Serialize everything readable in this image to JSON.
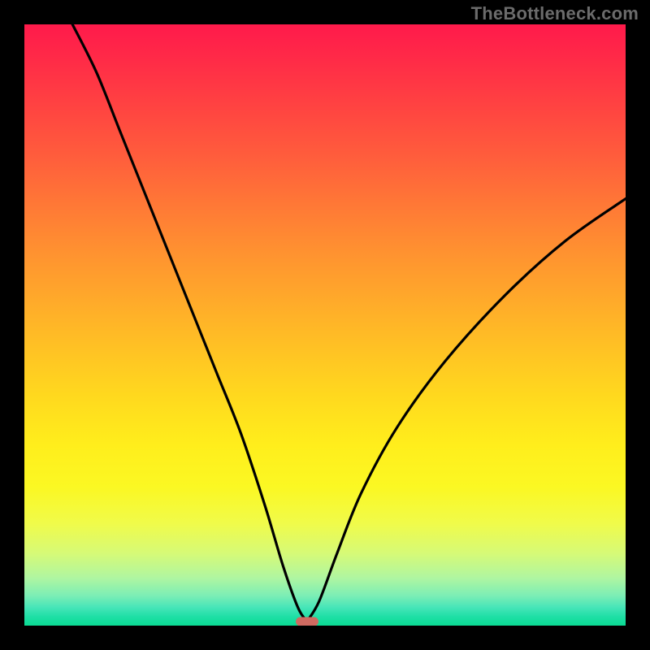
{
  "watermark": "TheBottleneck.com",
  "colors": {
    "frame_bg": "#000000",
    "watermark": "#6b6b6b",
    "curve_stroke": "#000000",
    "marker": "#cf6a61",
    "gradient_stops": [
      "#ff1a4b",
      "#ff2b47",
      "#ff4441",
      "#ff5d3c",
      "#ff7836",
      "#ff9230",
      "#ffaa2a",
      "#ffc224",
      "#ffd91e",
      "#ffee1c",
      "#fbf823",
      "#f0fb4a",
      "#d6fa77",
      "#b0f6a0",
      "#7ceeb5",
      "#46e5b8",
      "#1fdfa6",
      "#0adb93"
    ]
  },
  "chart_data": {
    "type": "line",
    "title": "",
    "xlabel": "",
    "ylabel": "",
    "xlim": [
      0,
      100
    ],
    "ylim": [
      0,
      100
    ],
    "notch_x": 47,
    "marker": {
      "x": 47,
      "y": 0.7,
      "color": "#cf6a61"
    },
    "left_branch": [
      {
        "x": 8,
        "y": 100
      },
      {
        "x": 12,
        "y": 92
      },
      {
        "x": 16,
        "y": 82
      },
      {
        "x": 20,
        "y": 72
      },
      {
        "x": 24,
        "y": 62
      },
      {
        "x": 28,
        "y": 52
      },
      {
        "x": 32,
        "y": 42
      },
      {
        "x": 36,
        "y": 32
      },
      {
        "x": 40,
        "y": 20
      },
      {
        "x": 43,
        "y": 10
      },
      {
        "x": 45.5,
        "y": 3
      },
      {
        "x": 47,
        "y": 0.7
      }
    ],
    "right_branch": [
      {
        "x": 47,
        "y": 0.7
      },
      {
        "x": 49,
        "y": 4
      },
      {
        "x": 52,
        "y": 12
      },
      {
        "x": 56,
        "y": 22
      },
      {
        "x": 62,
        "y": 33
      },
      {
        "x": 70,
        "y": 44
      },
      {
        "x": 80,
        "y": 55
      },
      {
        "x": 90,
        "y": 64
      },
      {
        "x": 100,
        "y": 71
      }
    ],
    "note": "Values are approximate, read visually from the plot; x and y are in percent of the plot area (0–100). y=0 is the bottom edge, y=100 is the top edge."
  }
}
